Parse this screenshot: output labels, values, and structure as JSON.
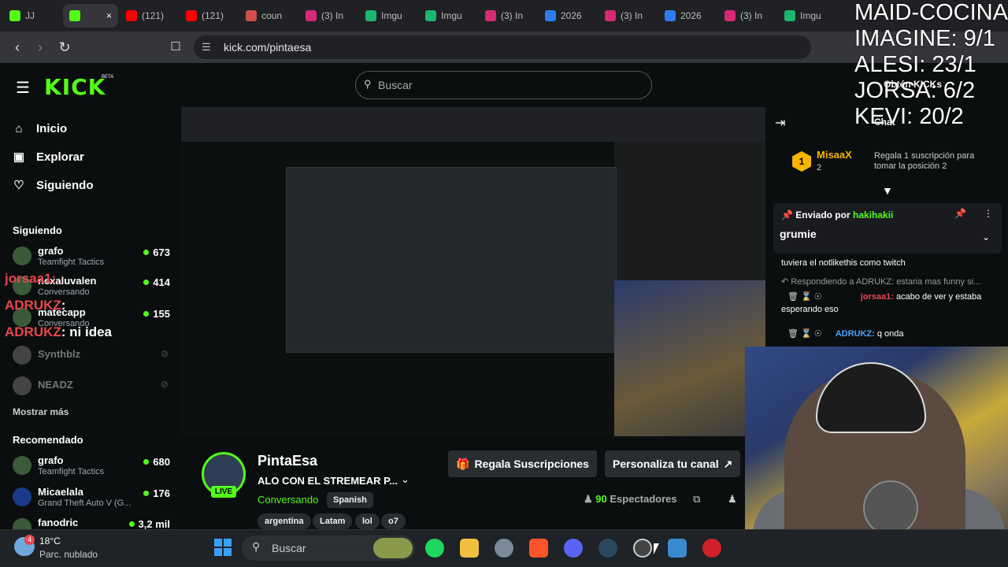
{
  "browser": {
    "tabs": [
      {
        "title": "JJ",
        "color": "#53fc18"
      },
      {
        "title": "",
        "color": "#53fc18",
        "active": true
      },
      {
        "title": "(121)",
        "color": "#ff0000"
      },
      {
        "title": "(121)",
        "color": "#ff0000"
      },
      {
        "title": "coun",
        "color": "#d24f4f"
      },
      {
        "title": "(3) In",
        "color": "#d62976"
      },
      {
        "title": "Imgu",
        "color": "#1bb76e"
      },
      {
        "title": "Imgu",
        "color": "#1bb76e"
      },
      {
        "title": "(3) In",
        "color": "#d62976"
      },
      {
        "title": "2026",
        "color": "#2e7df0"
      },
      {
        "title": "(3) In",
        "color": "#d62976"
      },
      {
        "title": "2026",
        "color": "#2e7df0"
      },
      {
        "title": "(3) In",
        "color": "#d62976"
      },
      {
        "title": "Imgu",
        "color": "#1bb76e"
      }
    ],
    "url": "kick.com/pintaesa"
  },
  "header": {
    "logo": "KICK",
    "logo_beta": "BETA",
    "search_placeholder": "Buscar"
  },
  "sidebar": {
    "nav": [
      {
        "label": "Inicio",
        "icon": "home-icon"
      },
      {
        "label": "Explorar",
        "icon": "browse-icon"
      },
      {
        "label": "Siguiendo",
        "icon": "heart-icon"
      }
    ],
    "following_title": "Siguiendo",
    "following": [
      {
        "name": "grafo",
        "game": "Teamfight Tactics",
        "viewers": "673"
      },
      {
        "name": "nexaluvalen",
        "game": "Conversando",
        "viewers": "414"
      },
      {
        "name": "matecapp",
        "game": "Conversando",
        "viewers": "155"
      },
      {
        "name": "Synthblz",
        "game": "",
        "viewers": ""
      },
      {
        "name": "NEADZ",
        "game": "",
        "viewers": ""
      }
    ],
    "show_more": "Mostrar más",
    "recommended_title": "Recomendado",
    "recommended": [
      {
        "name": "grafo",
        "game": "Teamfight Tactics",
        "viewers": "680"
      },
      {
        "name": "Micaelala",
        "game": "Grand Theft Auto V (G...",
        "viewers": "176"
      },
      {
        "name": "fanodric",
        "game": "",
        "viewers": "3,2 mil"
      }
    ]
  },
  "stream": {
    "name": "PintaEsa",
    "title": "ALO CON EL STREMEAR P...",
    "category": "Conversando",
    "language": "Spanish",
    "tags": [
      "argentina",
      "Latam",
      "lol",
      "o7"
    ],
    "live": "LIVE",
    "subs_button": "Regala Suscripciones",
    "customize_button": "Personaliza tu canal",
    "viewers_count": "90",
    "viewers_label": "Espectadores"
  },
  "chat": {
    "kicks_label": "Obtén KICKs",
    "chat_label": "Chat",
    "top_donor": {
      "name": "MisaaX",
      "rank": "1",
      "count": "2"
    },
    "gift_prompt": "Regala 1 suscripción para tomar la posición 2",
    "pinned_by_label": "Enviado por",
    "pinned_by_user": "hakihakii",
    "pinned_msg": "grumie",
    "messages": [
      {
        "text": "tuviera el notlikethis como twitch"
      },
      {
        "text": "Respondiendo a ADRUKZ: estaria mas funny si..."
      },
      {
        "user": "jorsaa1:",
        "text": "acabo de ver y estaba esperando eso"
      },
      {
        "user": "ADRUKZ:",
        "text": "q onda"
      }
    ]
  },
  "overlay": {
    "lines": [
      "MAID-COCINA",
      "IMAGINE: 9/1",
      "ALESI: 23/1",
      "JORSA: 6/2",
      "KEVI: 20/2"
    ],
    "chat_lines": [
      {
        "user": "jorsaa1",
        "text": ":"
      },
      {
        "user": "ADRUKZ",
        "text": ":"
      },
      {
        "user": "ADRUKZ",
        "text": ": ni idea"
      }
    ]
  },
  "taskbar": {
    "weather_temp": "18°C",
    "weather_desc": "Parc. nublado",
    "search_placeholder": "Buscar",
    "badge": "4"
  }
}
